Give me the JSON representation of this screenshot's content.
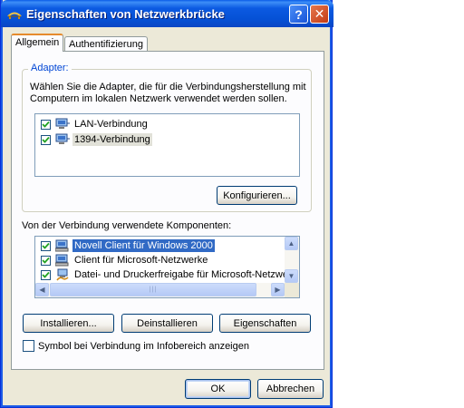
{
  "window": {
    "title": "Eigenschaften von Netzwerkbrücke",
    "help_glyph": "?",
    "close_glyph": "✕"
  },
  "tabs": [
    {
      "label": "Allgemein",
      "active": true
    },
    {
      "label": "Authentifizierung",
      "active": false
    }
  ],
  "adapter": {
    "legend": "Adapter:",
    "description": "Wählen Sie die Adapter, die für die Verbindungsherstellung mit Computern im lokalen Netzwerk verwendet werden sollen.",
    "items": [
      {
        "label": "LAN-Verbindung",
        "checked": true
      },
      {
        "label": "1394-Verbindung",
        "checked": true
      }
    ],
    "configure_label": "Konfigurieren..."
  },
  "components": {
    "label": "Von der Verbindung verwendete Komponenten:",
    "items": [
      {
        "label": "Novell Client für Windows 2000",
        "checked": true,
        "selected": true
      },
      {
        "label": "Client für Microsoft-Netzwerke",
        "checked": true
      },
      {
        "label": "Datei- und Druckerfreigabe für Microsoft-Netzwer",
        "checked": true
      }
    ],
    "install_label": "Installieren...",
    "uninstall_label": "Deinstallieren",
    "properties_label": "Eigenschaften"
  },
  "tray_icon": {
    "label": "Symbol bei Verbindung im Infobereich anzeigen",
    "checked": false
  },
  "footer": {
    "ok_label": "OK",
    "cancel_label": "Abbrechen"
  },
  "colors": {
    "titlebar": "#0551d6",
    "accent_tab": "#e68b2c",
    "selection": "#316ac5",
    "legend": "#0046d5"
  }
}
